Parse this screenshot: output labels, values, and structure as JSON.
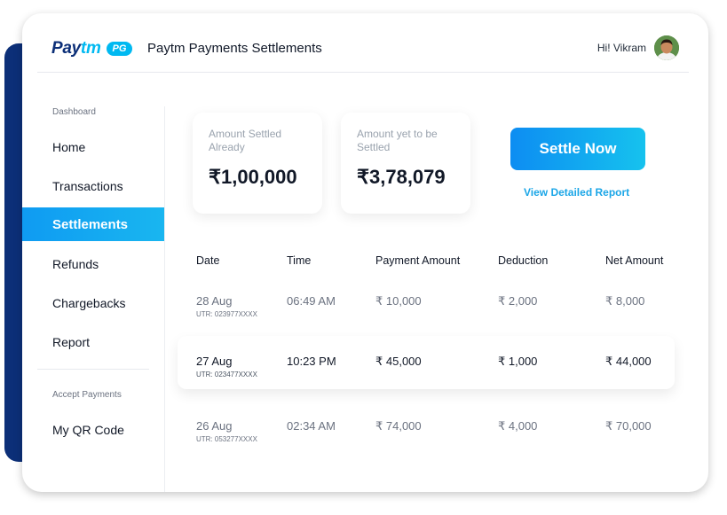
{
  "brand": {
    "logo_pay": "Pay",
    "logo_tm": "tm",
    "logo_badge": "PG",
    "title": "Paytm Payments Settlements"
  },
  "user": {
    "greeting": "Hi! Vikram"
  },
  "sidebar": {
    "heading": "Dashboard",
    "items": [
      {
        "label": "Home"
      },
      {
        "label": "Transactions"
      },
      {
        "label": "Settlements",
        "active": true
      },
      {
        "label": "Refunds"
      },
      {
        "label": "Chargebacks"
      },
      {
        "label": "Report"
      }
    ],
    "section2_heading": "Accept Payments",
    "section2_items": [
      {
        "label": "My QR Code"
      }
    ]
  },
  "stats": [
    {
      "label": "Amount Settled Already",
      "value": "₹1,00,000"
    },
    {
      "label": "Amount yet to be Settled",
      "value": "₹3,78,079"
    }
  ],
  "actions": {
    "settle_now": "Settle Now",
    "view_report": "View Detailed Report"
  },
  "table": {
    "columns": [
      "Date",
      "Time",
      "Payment Amount",
      "Deduction",
      "Net Amount"
    ],
    "rows": [
      {
        "date": "28 Aug",
        "utr": "UTR: 023977XXXX",
        "time": "06:49 AM",
        "payment": "₹ 10,000",
        "deduction": "₹ 2,000",
        "net": "₹ 8,000"
      },
      {
        "date": "27 Aug",
        "utr": "UTR: 023477XXXX",
        "time": "10:23 PM",
        "payment": "₹ 45,000",
        "deduction": "₹ 1,000",
        "net": "₹ 44,000",
        "highlighted": true
      },
      {
        "date": "26 Aug",
        "utr": "UTR: 053277XXXX",
        "time": "02:34 AM",
        "payment": "₹ 74,000",
        "deduction": "₹ 4,000",
        "net": "₹ 70,000"
      }
    ]
  },
  "colors": {
    "brand_navy": "#0c2f78",
    "brand_cyan": "#00b9f1",
    "active_nav": "#0f9bf2"
  }
}
